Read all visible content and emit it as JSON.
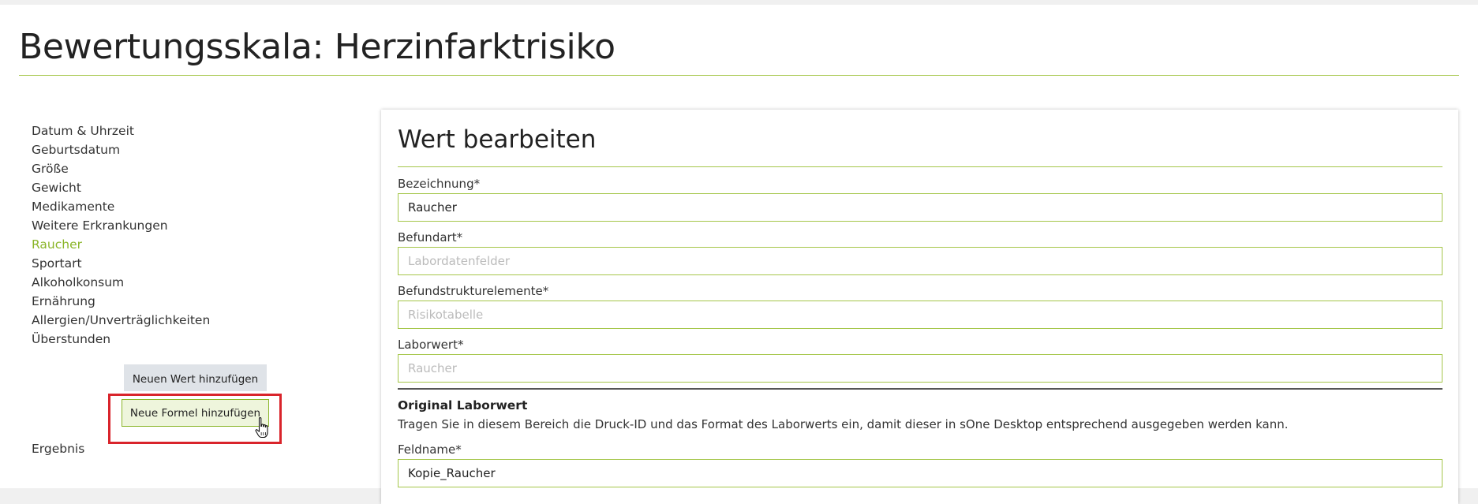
{
  "page": {
    "title": "Bewertungsskala: Herzinfarktrisiko"
  },
  "sidebar": {
    "items": [
      {
        "label": "Datum & Uhrzeit",
        "active": false
      },
      {
        "label": "Geburtsdatum",
        "active": false
      },
      {
        "label": "Größe",
        "active": false
      },
      {
        "label": "Gewicht",
        "active": false
      },
      {
        "label": "Medikamente",
        "active": false
      },
      {
        "label": "Weitere Erkrankungen",
        "active": false
      },
      {
        "label": "Raucher",
        "active": true
      },
      {
        "label": "Sportart",
        "active": false
      },
      {
        "label": "Alkoholkonsum",
        "active": false
      },
      {
        "label": "Ernährung",
        "active": false
      },
      {
        "label": "Allergien/Unverträglichkeiten",
        "active": false
      },
      {
        "label": "Überstunden",
        "active": false
      }
    ],
    "add_value_label": "Neuen Wert hinzufügen",
    "add_formula_label": "Neue Formel hinzufügen",
    "result_label": "Ergebnis"
  },
  "editor": {
    "title": "Wert bearbeiten",
    "fields": {
      "bezeichnung": {
        "label": "Bezeichnung*",
        "value": "Raucher",
        "placeholder": ""
      },
      "befundart": {
        "label": "Befundart*",
        "value": "",
        "placeholder": "Labordatenfelder"
      },
      "befundstrukturelemente": {
        "label": "Befundstrukturelemente*",
        "value": "",
        "placeholder": "Risikotabelle"
      },
      "laborwert": {
        "label": "Laborwert*",
        "value": "",
        "placeholder": "Raucher"
      },
      "feldname": {
        "label": "Feldname*",
        "value": "Kopie_Raucher",
        "placeholder": ""
      }
    },
    "original_section": {
      "heading": "Original Laborwert",
      "description": "Tragen Sie in diesem Bereich die Druck-ID und das Format des Laborwerts ein, damit dieser in sOne Desktop entsprechend ausgegeben werden kann."
    }
  },
  "colors": {
    "accent": "#8ab528",
    "rule": "#a5c64a",
    "highlight": "#d9242b"
  }
}
